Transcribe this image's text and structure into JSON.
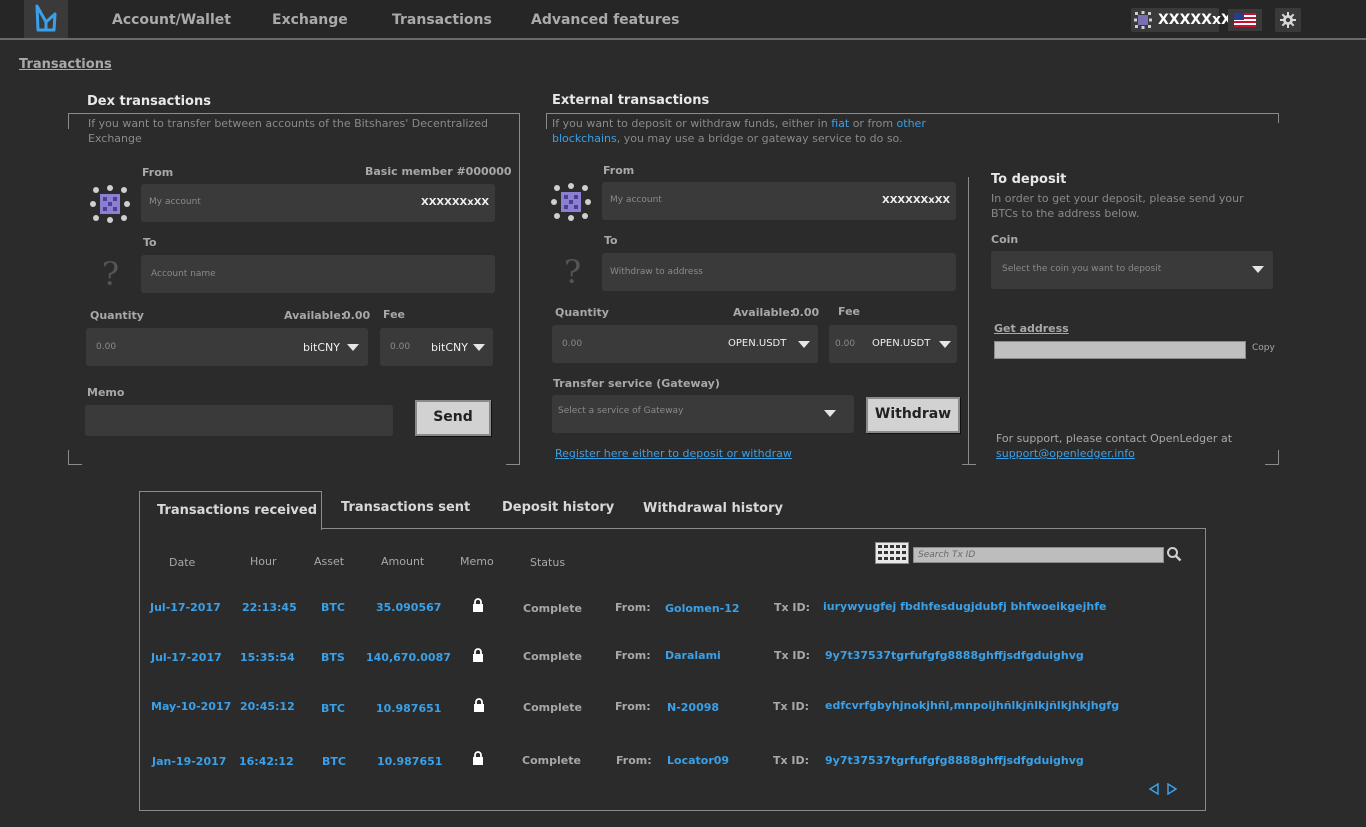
{
  "nav": {
    "items": [
      "Account/Wallet",
      "Exchange",
      "Transactions",
      "Advanced features"
    ],
    "account_name": "XXXXXxX"
  },
  "breadcrumb": "Transactions",
  "dex": {
    "title": "Dex transactions",
    "description": "If you want to transfer between accounts of the Bitshares' Decentralized Exchange",
    "from_label": "From",
    "member_label": "Basic member #000000",
    "from_placeholder": "My account",
    "from_value": "XXXXXXxXX",
    "to_label": "To",
    "to_placeholder": "Account name",
    "quantity_label": "Quantity",
    "available_label": "Available:",
    "available_value": "0.00",
    "fee_label": "Fee",
    "quantity_value": "0.00",
    "quantity_asset": "bitCNY",
    "fee_value": "0.00",
    "fee_asset": "bitCNY",
    "memo_label": "Memo",
    "send_label": "Send"
  },
  "external": {
    "title": "External transactions",
    "desc_prefix": "If you want to deposit or withdraw funds, either in ",
    "desc_link1": "fiat",
    "desc_mid": " or from ",
    "desc_link2a": "other",
    "desc_link2b": "blockchains",
    "desc_suffix": ", you may use a bridge or gateway service to do so.",
    "from_label": "From",
    "from_placeholder": "My account",
    "from_value": "XXXXXXxXX",
    "to_label": "To",
    "to_placeholder": "Withdraw to address",
    "quantity_label": "Quantity",
    "available_label": "Available:",
    "available_value": "0.00",
    "fee_label": "Fee",
    "quantity_value": "0.00",
    "quantity_asset": "OPEN.USDT",
    "fee_value": "0.00",
    "fee_asset": "OPEN.USDT",
    "gateway_label": "Transfer service (Gateway)",
    "gateway_placeholder": "Select a service of Gateway",
    "withdraw_label": "Withdraw",
    "register_link": "Register here either to deposit or withdraw"
  },
  "deposit": {
    "title": "To deposit",
    "description": "In order to get your deposit, please send your BTCs to the address below.",
    "coin_label": "Coin",
    "coin_placeholder": "Select the coin you want to deposit",
    "get_address": "Get address",
    "copy_label": "Copy",
    "support_text": "For support, please contact OpenLedger at",
    "support_email": "support@openledger.info"
  },
  "tabs": [
    "Transactions received",
    "Transactions sent",
    "Deposit history",
    "Withdrawal history"
  ],
  "table": {
    "headers": [
      "Date",
      "Hour",
      "Asset",
      "Amount",
      "Memo",
      "Status"
    ],
    "search_placeholder": "Search Tx ID",
    "from_label": "From:",
    "txid_label": "Tx ID:",
    "rows": [
      {
        "date": "Jul-17-2017",
        "hour": "22:13:45",
        "asset": "BTC",
        "amount": "35.090567",
        "status": "Complete",
        "from": "Golomen-12",
        "txid": "iurywyugfej fbdhfesdugjdubfj bhfwoeikgejhfe"
      },
      {
        "date": "Jul-17-2017",
        "hour": "15:35:54",
        "asset": "BTS",
        "amount": "140,670.0087",
        "status": "Complete",
        "from": "Daralami",
        "txid": "9y7t37537tgrfufgfg8888ghffjsdfgduighvg"
      },
      {
        "date": "May-10-2017",
        "hour": "20:45:12",
        "asset": "BTC",
        "amount": "10.987651",
        "status": "Complete",
        "from": "N-20098",
        "txid": "edfcvrfgbyhjnokjhñl,mnpoijhñlkjñlkjñlkjhkjhgfg"
      },
      {
        "date": "Jan-19-2017",
        "hour": "16:42:12",
        "asset": "BTC",
        "amount": "10.987651",
        "status": "Complete",
        "from": "Locator09",
        "txid": "9y7t37537tgrfufgfg8888ghffjsdfgduighvg"
      }
    ]
  },
  "colors": {
    "accent": "#3aa0e8",
    "background": "#2b2b2b"
  }
}
